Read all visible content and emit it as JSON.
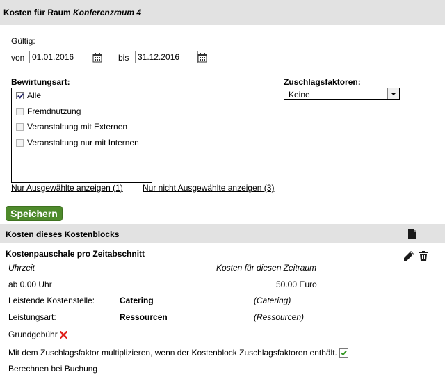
{
  "header": {
    "title_prefix": "Kosten für Raum",
    "room_name": "Konferenzraum 4"
  },
  "validity": {
    "label": "Gültig:",
    "from_label": "von",
    "from_value": "01.01.2016",
    "to_label": "bis",
    "to_value": "31.12.2016"
  },
  "catering": {
    "label": "Bewirtungsart:",
    "options": [
      {
        "label": "Alle",
        "checked": true
      },
      {
        "label": "Fremdnutzung",
        "checked": false
      },
      {
        "label": "Veranstaltung mit Externen",
        "checked": false
      },
      {
        "label": "Veranstaltung nur mit Internen",
        "checked": false
      }
    ],
    "show_selected_link": "Nur Ausgewählte anzeigen (1)",
    "show_unselected_link": "Nur nicht Ausgewählte anzeigen (3)"
  },
  "surcharge": {
    "label": "Zuschlagsfaktoren:",
    "selected": "Keine"
  },
  "save_button": "Speichern",
  "cost_block": {
    "title": "Kosten dieses Kostenblocks",
    "item_title": "Kostenpauschale pro Zeitabschnitt",
    "col_time": "Uhrzeit",
    "col_cost": "Kosten für diesen Zeitraum",
    "time_value": "ab 0.00 Uhr",
    "cost_value": "50.00 Euro",
    "cost_center_label": "Leistende Kostenstelle:",
    "cost_center_value": "Catering",
    "cost_center_note": "(Catering)",
    "service_type_label": "Leistungsart:",
    "service_type_value": "Ressourcen",
    "service_type_note": "(Ressourcen)",
    "base_fee_label": "Grundgebühr",
    "multiply_text": "Mit dem Zuschlagsfaktor multiplizieren, wenn der Kostenblock Zuschlagsfaktoren enthält.",
    "calc_text": "Berechnen bei Buchung"
  },
  "colors": {
    "accent_green": "#4e8a2b",
    "header_gray": "#e2e2e2",
    "cross_red": "#e0201c"
  }
}
